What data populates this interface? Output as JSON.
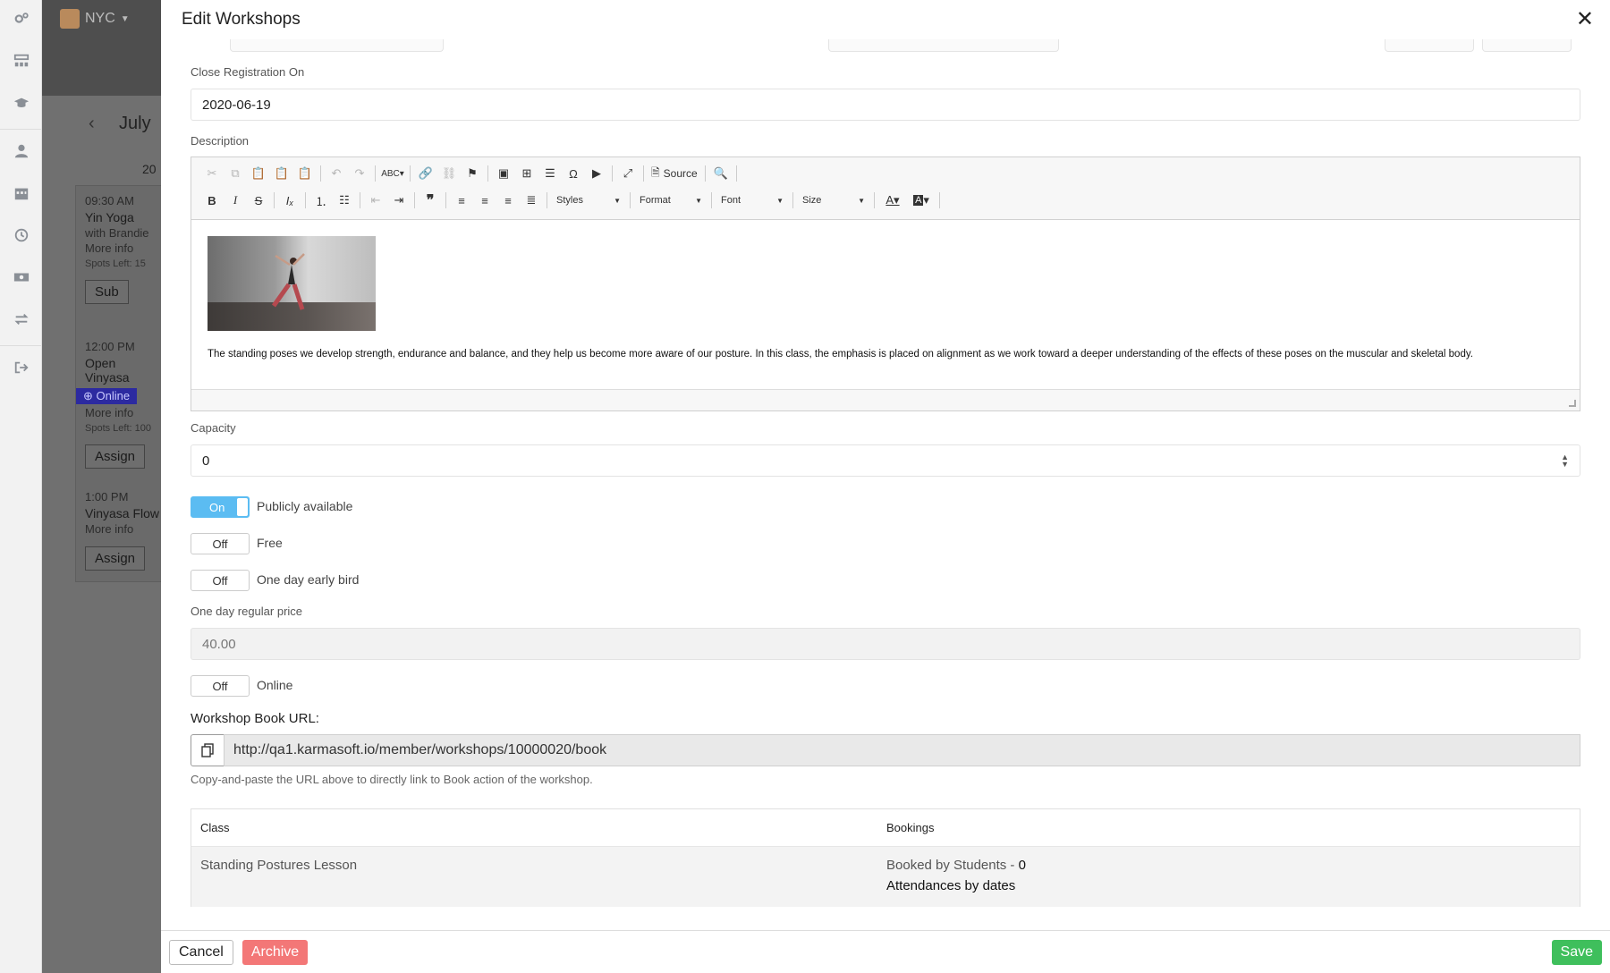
{
  "background_app": {
    "location": "NYC",
    "month": "July",
    "day": "20",
    "events": [
      {
        "time": "09:30 AM",
        "name": "Yin Yoga",
        "sub": "with Brandie",
        "info": "More info",
        "spots": "Spots Left: 15",
        "action": "Sub"
      },
      {
        "time": "12:00 PM",
        "name": "Open Vinyasa",
        "badge": "Online",
        "info": "More info",
        "spots": "Spots Left: 100",
        "action": "Assign"
      },
      {
        "time": "1:00 PM",
        "name": "Vinyasa Flow",
        "info": "More info",
        "action": "Assign"
      }
    ]
  },
  "modal": {
    "title": "Edit Workshops",
    "close_icon": "close-icon"
  },
  "form": {
    "close_registration_label": "Close Registration On",
    "close_registration_value": "2020-06-19",
    "description_label": "Description",
    "editor": {
      "source_label": "Source",
      "styles_label": "Styles",
      "format_label": "Format",
      "font_label": "Font",
      "size_label": "Size",
      "content_text": "The standing poses we develop strength, endurance and balance, and they help us become more aware of our posture. In this class, the emphasis is placed on alignment as we work toward a deeper understanding of the effects of these poses on the muscular and skeletal body."
    },
    "capacity_label": "Capacity",
    "capacity_value": "0",
    "toggles": {
      "public": {
        "state": "On",
        "label": "Publicly available"
      },
      "free": {
        "state": "Off",
        "label": "Free"
      },
      "early_bird": {
        "state": "Off",
        "label": "One day early bird"
      },
      "online": {
        "state": "Off",
        "label": "Online"
      }
    },
    "regular_price_label": "One day regular price",
    "regular_price_value": "40.00",
    "book_url_label": "Workshop Book URL:",
    "book_url_value": "http://qa1.karmasoft.io/member/workshops/10000020/book",
    "book_url_help": "Copy-and-paste the URL above to directly link to Book action of the workshop."
  },
  "table": {
    "headers": [
      "Class",
      "Bookings"
    ],
    "rows": [
      {
        "class": "Standing Postures Lesson",
        "booked_label": "Booked by Students - ",
        "booked_count": "0",
        "attendances": "Attendances by dates"
      }
    ]
  },
  "footer": {
    "cancel_label": "Cancel",
    "archive_label": "Archive",
    "save_label": "Save"
  },
  "colors": {
    "toggle_on": "#5bbcf2",
    "archive": "#f37777",
    "save": "#3fbf5c",
    "online_badge": "#2c2aa0"
  }
}
